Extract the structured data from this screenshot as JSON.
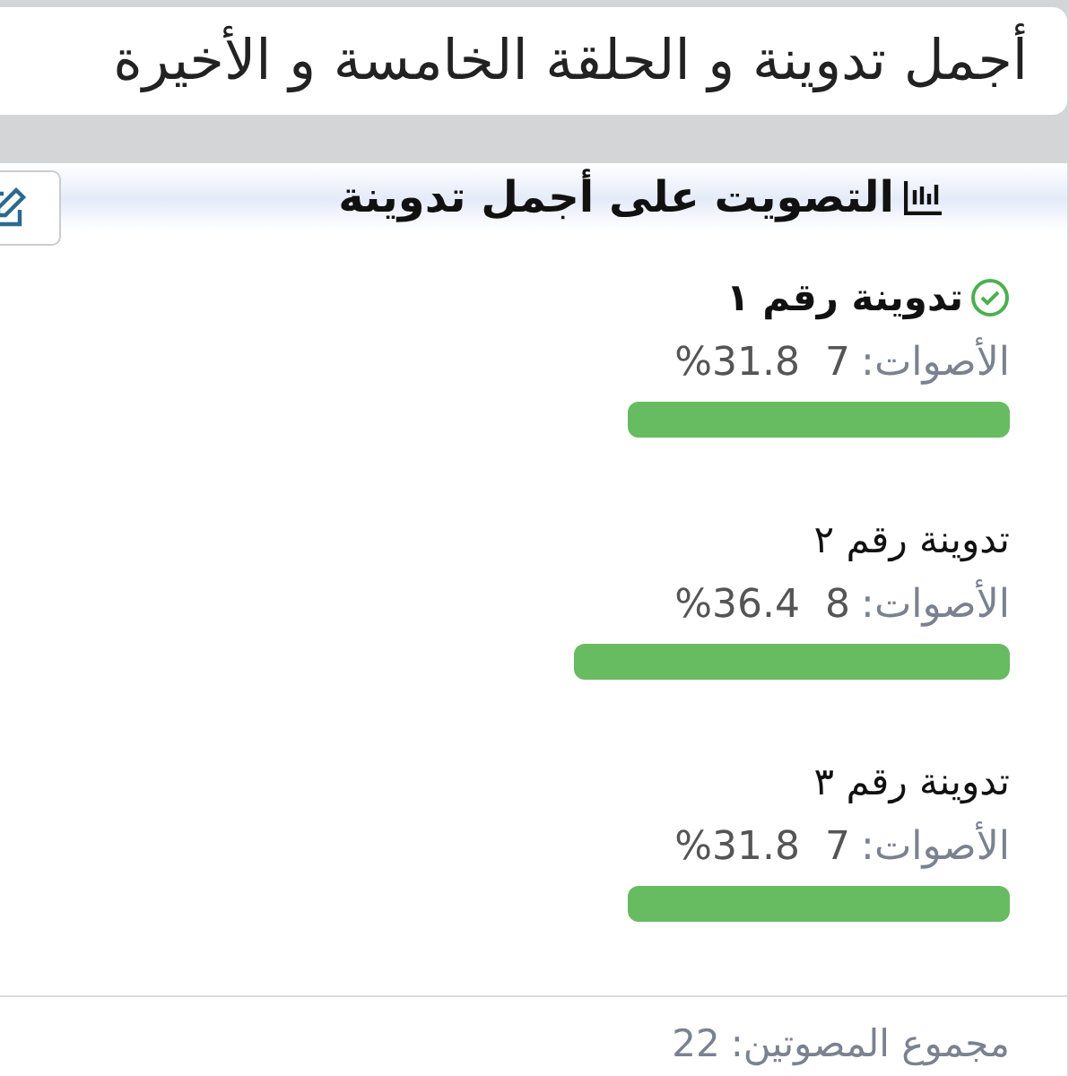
{
  "post_title": "أجمل تدوينة و الحلقة الخامسة و الأخيرة",
  "poll": {
    "title": "التصويت على أجمل تدوينة",
    "options": [
      {
        "label": "تدوينة رقم ١",
        "selected": true,
        "votes_label": "الأصوات:",
        "votes": "7",
        "percent": "%31.8"
      },
      {
        "label": "تدوينة رقم ٢",
        "selected": false,
        "votes_label": "الأصوات:",
        "votes": "8",
        "percent": "%36.4"
      },
      {
        "label": "تدوينة رقم ٣",
        "selected": false,
        "votes_label": "الأصوات:",
        "votes": "7",
        "percent": "%31.8"
      }
    ],
    "total_label": "مجموع المصوتين:",
    "total": "22"
  }
}
